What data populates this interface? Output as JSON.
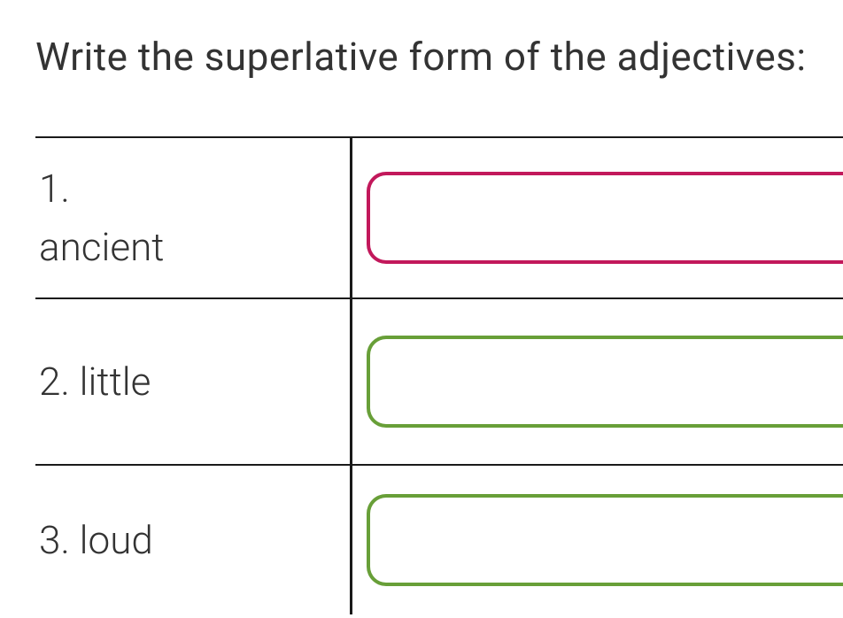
{
  "instruction": "Write the superlative form of the adjectives:",
  "rows": [
    {
      "label": "1.\nancient",
      "value": "",
      "color": "magenta"
    },
    {
      "label": "2. little",
      "value": "",
      "color": "green"
    },
    {
      "label": "3. loud",
      "value": "",
      "color": "green"
    }
  ]
}
